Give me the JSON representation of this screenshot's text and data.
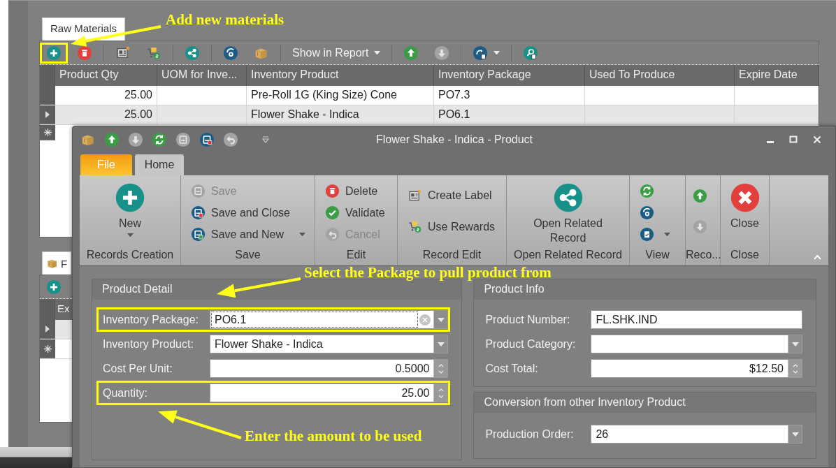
{
  "main_window": {
    "tabs": [
      {
        "label": "Raw Materials",
        "selected": true
      }
    ],
    "toolbar": [
      {
        "kind": "add",
        "disabled": false,
        "highlighted": true,
        "dropdown": false
      },
      {
        "kind": "delete",
        "disabled": false,
        "highlighted": false,
        "dropdown": false
      },
      {
        "kind": "separator"
      },
      {
        "kind": "label",
        "disabled": false,
        "highlighted": false,
        "dropdown": false
      },
      {
        "kind": "rewards",
        "disabled": false,
        "highlighted": false,
        "dropdown": false
      },
      {
        "kind": "separator"
      },
      {
        "kind": "share",
        "disabled": false,
        "highlighted": false,
        "dropdown": false
      },
      {
        "kind": "separator"
      },
      {
        "kind": "settings",
        "disabled": false,
        "highlighted": false,
        "dropdown": false
      },
      {
        "kind": "box",
        "disabled": false,
        "highlighted": false,
        "dropdown": false
      },
      {
        "kind": "separator"
      },
      {
        "kind": "menu",
        "label": "Show in Report",
        "disabled": false,
        "highlighted": false,
        "dropdown": true
      },
      {
        "kind": "separator"
      },
      {
        "kind": "up",
        "disabled": false,
        "highlighted": false,
        "dropdown": false
      },
      {
        "kind": "down",
        "disabled": true,
        "highlighted": false,
        "dropdown": false
      },
      {
        "kind": "separator"
      },
      {
        "kind": "export",
        "disabled": false,
        "highlighted": false,
        "dropdown": true
      },
      {
        "kind": "separator"
      },
      {
        "kind": "find",
        "disabled": false,
        "highlighted": false,
        "dropdown": false
      }
    ],
    "columns": [
      "Product Qty",
      "UOM for Inve...",
      "Inventory Product",
      "Inventory Package",
      "Used To Produce",
      "Expire Date"
    ],
    "rows": [
      {
        "product_qty": "25.00",
        "inventory_product": "Pre-Roll 1G (King Size) Cone",
        "inventory_package": "PO7.3",
        "selected": false
      },
      {
        "product_qty": "25.00",
        "inventory_product": "Flower Shake - Indica",
        "inventory_package": "PO6.1",
        "selected": true
      }
    ]
  },
  "second_panel": {
    "tab": "F",
    "column": "Ex",
    "rows": [
      {
        "selected": true
      }
    ]
  },
  "dialog": {
    "title": "Flower Shake - Indica - Product",
    "quick_access": [
      {
        "kind": "box",
        "disabled": false
      },
      {
        "kind": "up",
        "disabled": false
      },
      {
        "kind": "down",
        "disabled": true
      },
      {
        "kind": "refresh",
        "disabled": false
      },
      {
        "kind": "save",
        "disabled": true
      },
      {
        "kind": "save-close",
        "disabled": false
      },
      {
        "kind": "undo",
        "disabled": true
      }
    ],
    "ribbon_tabs": [
      {
        "label": "File",
        "kind": "application",
        "selected": false
      },
      {
        "label": "Home",
        "kind": "page",
        "selected": true
      }
    ],
    "ribbon_groups": [
      {
        "label": "Records Creation",
        "kind": "large",
        "items": [
          {
            "kind": "add",
            "label": "New",
            "disabled": false,
            "dropdown": true
          }
        ]
      },
      {
        "label": "Save",
        "kind": "stack",
        "items": [
          {
            "kind": "save",
            "label": "Save",
            "disabled": true,
            "dropdown": false
          },
          {
            "kind": "save-close",
            "label": "Save and Close",
            "disabled": false,
            "dropdown": false
          },
          {
            "kind": "save-new",
            "label": "Save and New",
            "disabled": false,
            "dropdown": true
          }
        ]
      },
      {
        "label": "Edit",
        "kind": "stack",
        "items": [
          {
            "kind": "delete",
            "label": "Delete",
            "disabled": false,
            "dropdown": false
          },
          {
            "kind": "validate",
            "label": "Validate",
            "disabled": false,
            "dropdown": false
          },
          {
            "kind": "cancel",
            "label": "Cancel",
            "disabled": true,
            "dropdown": false
          }
        ]
      },
      {
        "label": "Record Edit",
        "kind": "spread",
        "items": [
          {
            "kind": "label",
            "label": "Create Label",
            "disabled": false,
            "dropdown": false
          },
          {
            "kind": "rewards",
            "label": "Use Rewards",
            "disabled": false,
            "dropdown": false
          }
        ]
      },
      {
        "label": "Open Related Record",
        "kind": "large",
        "items": [
          {
            "kind": "share",
            "label": "Open Related Record",
            "disabled": false,
            "dropdown": false
          }
        ]
      },
      {
        "label": "View",
        "kind": "stack",
        "items": [
          {
            "kind": "refresh",
            "disabled": false,
            "dropdown": false
          },
          {
            "kind": "settings",
            "disabled": false,
            "dropdown": false
          },
          {
            "kind": "checklist",
            "disabled": false,
            "dropdown": true
          }
        ]
      },
      {
        "label": "Reco...",
        "kind": "spread",
        "items": [
          {
            "kind": "up",
            "disabled": false,
            "dropdown": false
          },
          {
            "kind": "down",
            "disabled": true,
            "dropdown": false
          }
        ]
      },
      {
        "label": "Close",
        "kind": "large",
        "items": [
          {
            "kind": "close",
            "label": "Close",
            "disabled": false,
            "dropdown": false
          }
        ]
      }
    ],
    "sections": [
      {
        "title": "Product Detail",
        "fields": [
          {
            "label": "Inventory Package:",
            "value": "PO6.1",
            "kind": "lookup",
            "highlighted": true,
            "focused": true
          },
          {
            "label": "Inventory Product:",
            "value": "Flower Shake - Indica",
            "kind": "combo",
            "highlighted": false,
            "focused": false
          },
          {
            "label": "Cost Per Unit:",
            "value": "0.5000",
            "kind": "spin",
            "highlighted": false,
            "focused": false
          },
          {
            "label": "Quantity:",
            "value": "25.00",
            "kind": "spin",
            "highlighted": true,
            "focused": false
          }
        ]
      },
      {
        "title": "Product Info",
        "fields": [
          {
            "label": "Product Number:",
            "value": "FL.SHK.IND",
            "kind": "text",
            "highlighted": false,
            "focused": false
          },
          {
            "label": "Product Category:",
            "kind": "combo",
            "highlighted": false,
            "focused": false
          },
          {
            "label": "Cost Total:",
            "value": "$12.50",
            "kind": "spin",
            "highlighted": false,
            "focused": false
          }
        ]
      },
      {
        "title": "Conversion from other Inventory Product",
        "fields": [
          {
            "label": "Production Order:",
            "value": "26",
            "kind": "combo",
            "highlighted": false,
            "focused": false
          }
        ]
      }
    ]
  },
  "annotations": [
    {
      "text": "Add new materials"
    },
    {
      "text": "Select the Package to pull product from"
    },
    {
      "text": "Enter the amount to be used"
    }
  ]
}
